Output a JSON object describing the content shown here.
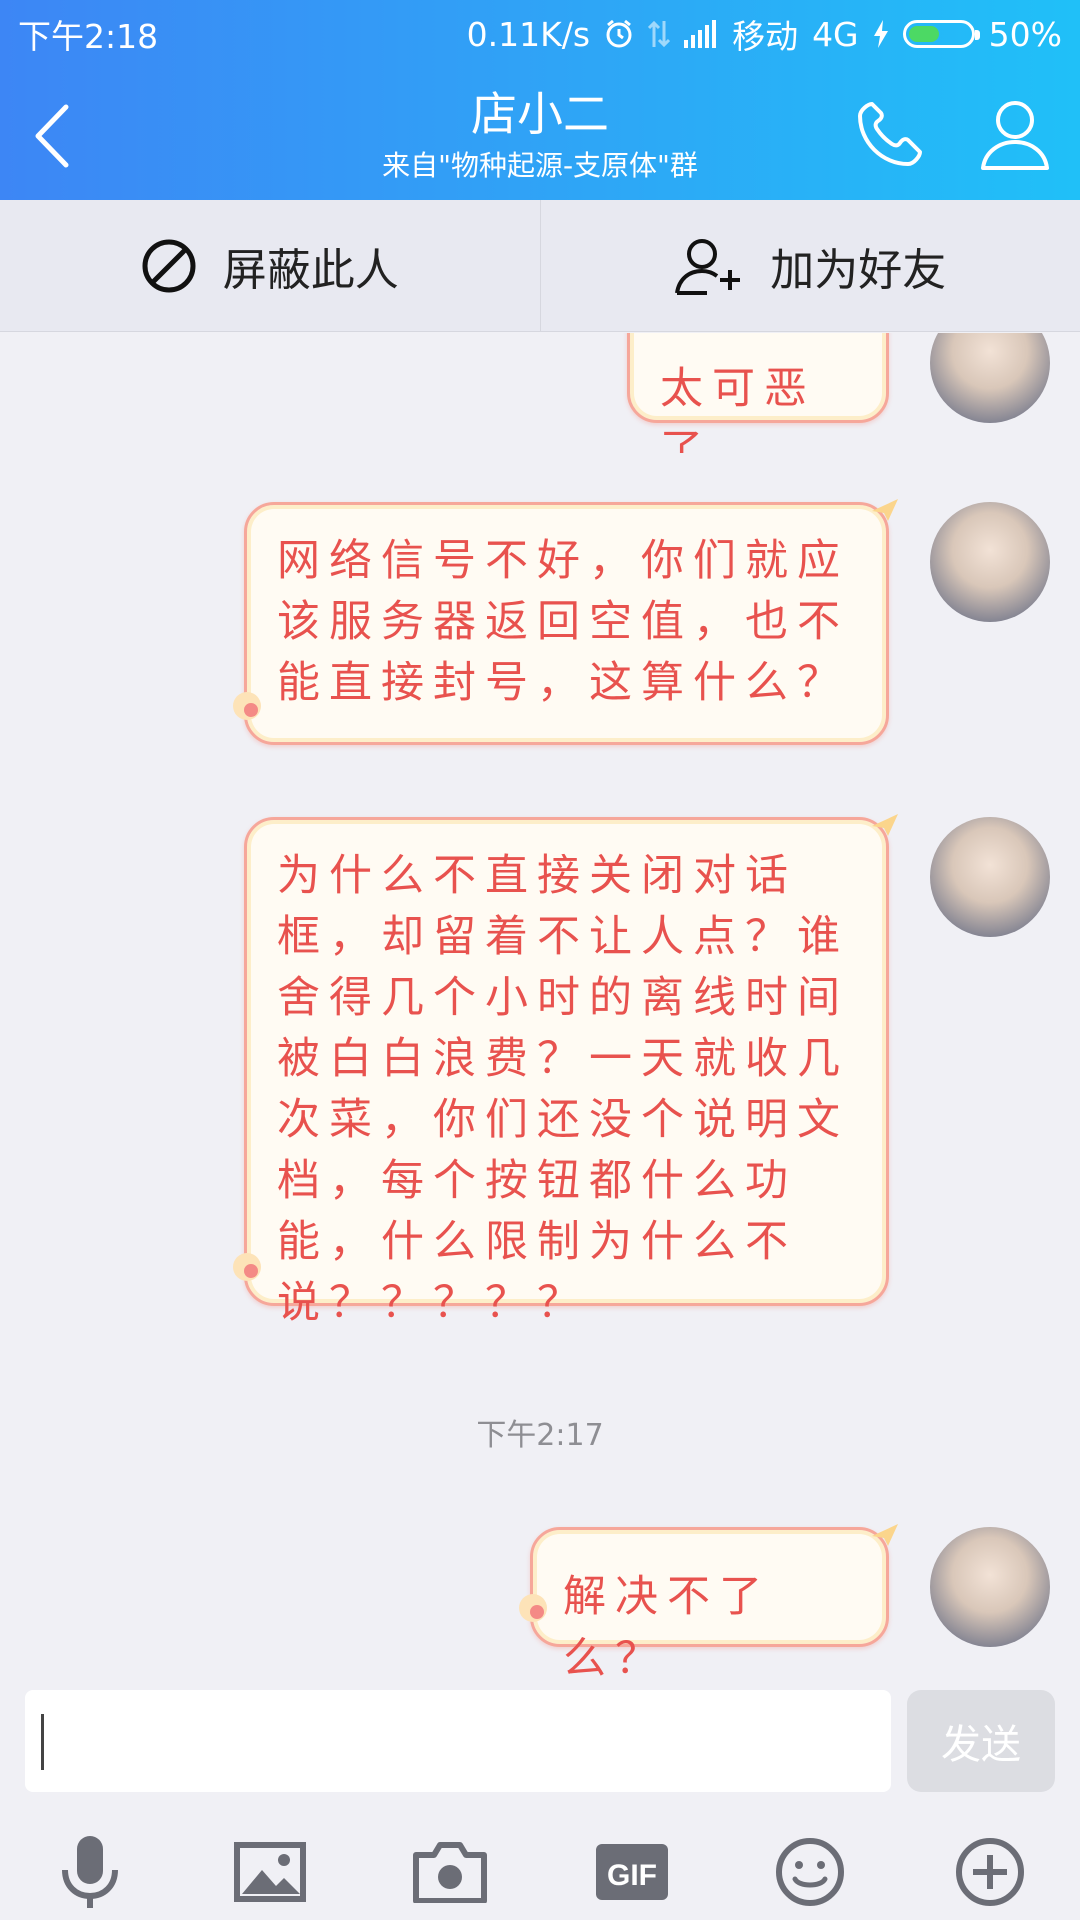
{
  "statusbar": {
    "time": "下午2:18",
    "net_speed": "0.11K/s",
    "carrier": "移动",
    "network": "4G",
    "battery": "50%",
    "battery_level": 0.5
  },
  "header": {
    "title": "店小二",
    "subtitle": "来自\"物种起源-支原体\"群"
  },
  "actions": {
    "block": "屏蔽此人",
    "add_friend": "加为好友"
  },
  "messages": [
    {
      "text": "太可恶了"
    },
    {
      "text": "网络信号不好，你们就应该服务器返回空值，也不能直接封号，这算什么？"
    },
    {
      "text": "为什么不直接关闭对话框，却留着不让人点？谁舍得几个小时的离线时间被白白浪费？一天就收几次菜，你们还没个说明文档，每个按钮都什么功能，什么限制为什么不说？？？？？"
    },
    {
      "text": "解决不了么？"
    }
  ],
  "timestamp": "下午2:17",
  "input": {
    "value": "",
    "send_label": "发送"
  },
  "toolbar": {
    "icons": [
      "microphone-icon",
      "image-icon",
      "camera-icon",
      "gif-icon",
      "emoji-icon",
      "plus-icon"
    ],
    "gif_label": "GIF"
  },
  "colors": {
    "header_start": "#3d86f5",
    "header_end": "#20c0f8",
    "bubble_text": "#e8524e",
    "bubble_border": "#f6a79a",
    "background": "#f0f0f5"
  }
}
